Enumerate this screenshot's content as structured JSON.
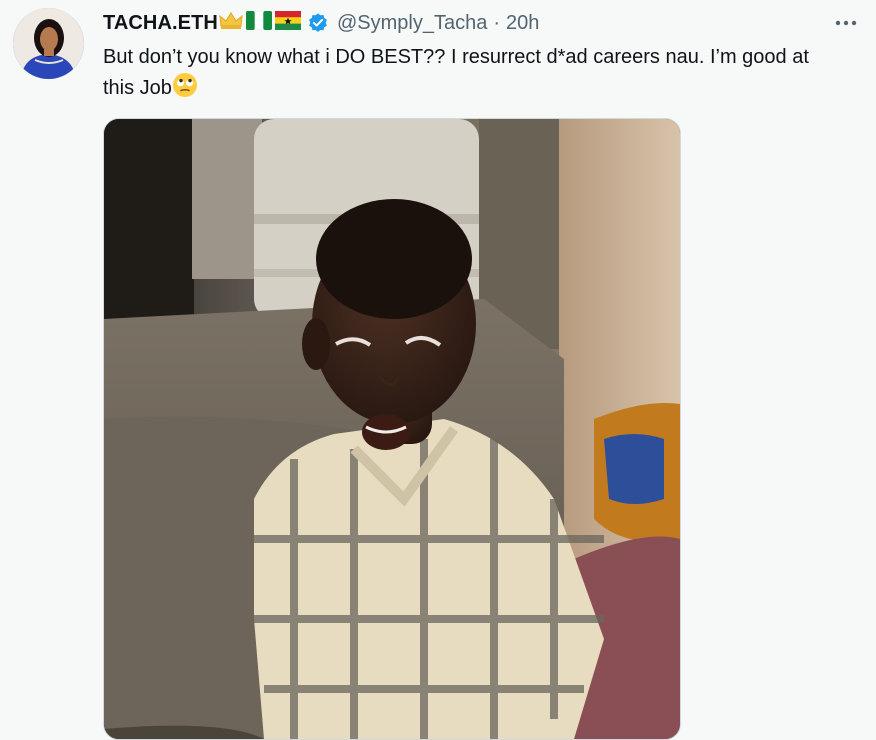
{
  "tweet": {
    "author_name": "TACHA.ETH",
    "author_handle": "@Symply_Tacha",
    "separator": "·",
    "timestamp": "20h",
    "text_main": "But don’t you know what i DO BEST?? I resurrect d*ad careers nau. I’m good at this Job",
    "text_emoji": "🙄",
    "icons": {
      "name_badge_1": "crown-emoji",
      "name_badge_2": "nigeria-flag-emoji",
      "name_badge_3": "ghana-flag-emoji",
      "verified": "verified-badge-icon",
      "more": "more-options-icon"
    },
    "colors": {
      "verified_blue": "#1d9bf0",
      "secondary_text": "#536471",
      "primary_text": "#0f1419",
      "background": "#f7f9f9"
    }
  }
}
